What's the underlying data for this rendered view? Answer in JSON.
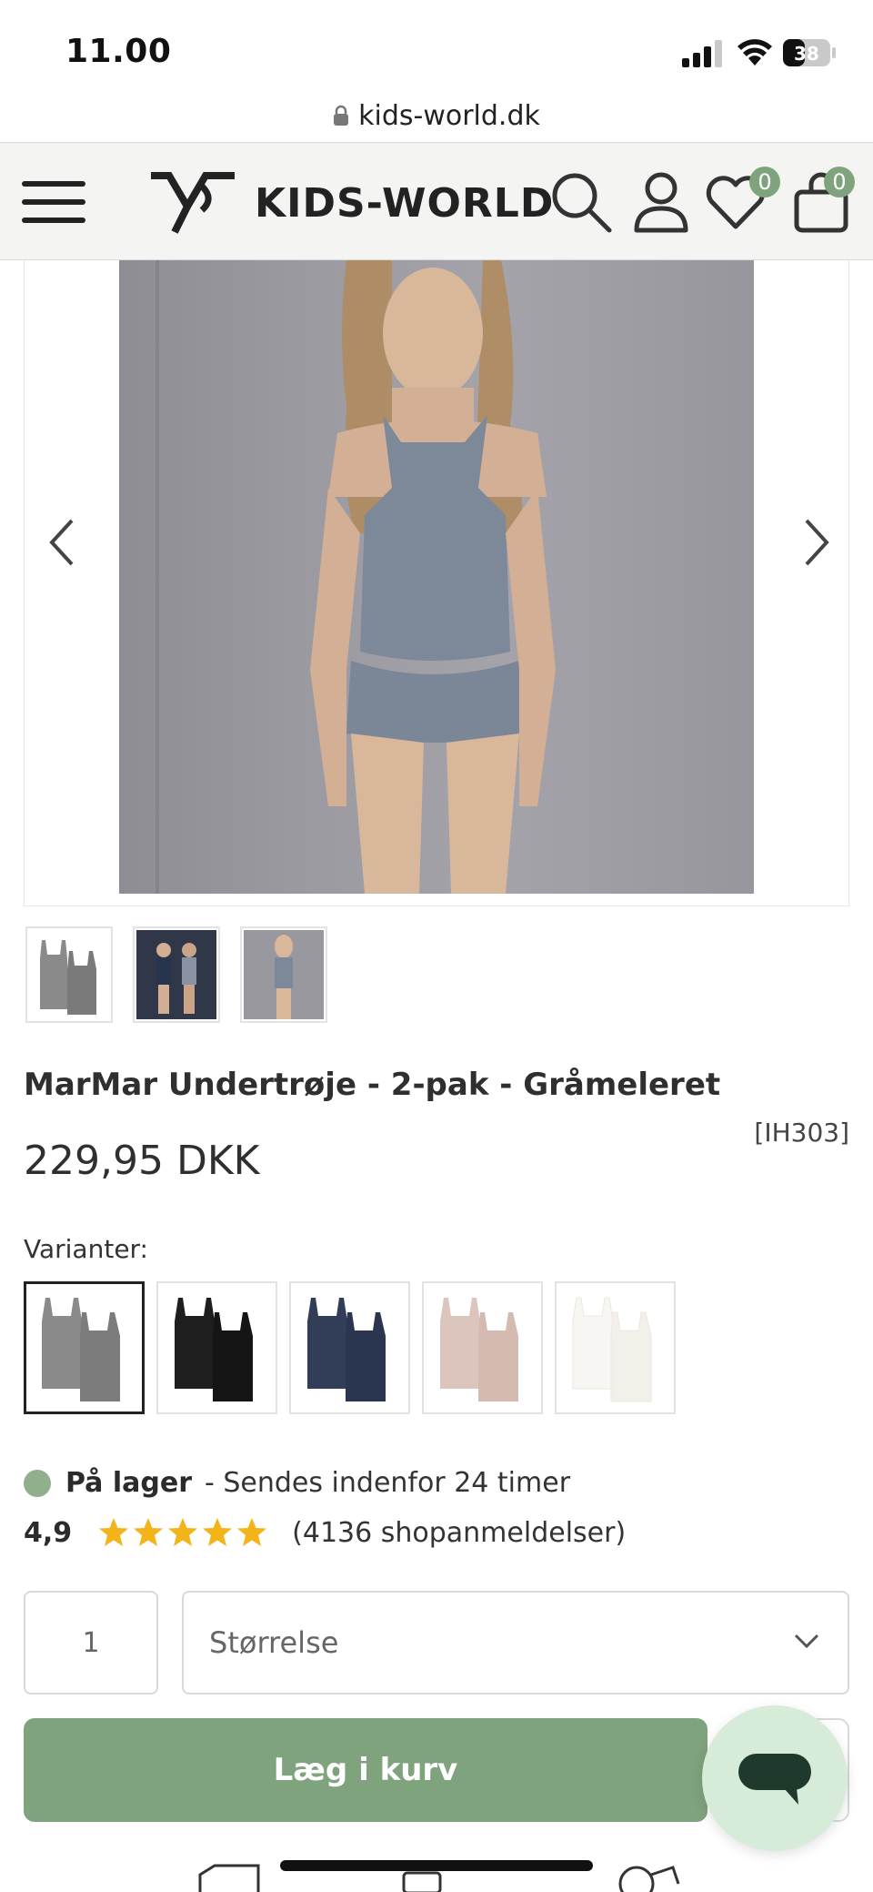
{
  "status_bar": {
    "time": "11.00",
    "battery": "38"
  },
  "url_bar": {
    "domain": "kids-world.dk"
  },
  "header": {
    "logo_text": "KIDS-WORLD",
    "wishlist_count": "0",
    "cart_count": "0"
  },
  "product": {
    "title": "MarMar Undertrøje - 2-pak - Gråmeleret",
    "sku": "[IH303]",
    "price": "229,95 DKK",
    "variants_label": "Varianter:",
    "variants": [
      {
        "color": "#8a8a8a",
        "name": "gray"
      },
      {
        "color": "#1c1c1c",
        "name": "black"
      },
      {
        "color": "#2e3a52",
        "name": "navy"
      },
      {
        "color": "#d8bfb8",
        "name": "rose"
      },
      {
        "color": "#f7f5f1",
        "name": "white"
      }
    ],
    "stock_status": "På lager",
    "stock_note": "- Sendes indenfor 24 timer",
    "rating": "4,9",
    "stars": 5,
    "reviews": "(4136 shopanmeldelser)",
    "quantity": "1",
    "size_placeholder": "Størrelse",
    "add_to_cart": "Læg i kurv"
  },
  "colors": {
    "accent": "#7fa37d",
    "stock": "#8fb08a",
    "star": "#f2b419"
  }
}
